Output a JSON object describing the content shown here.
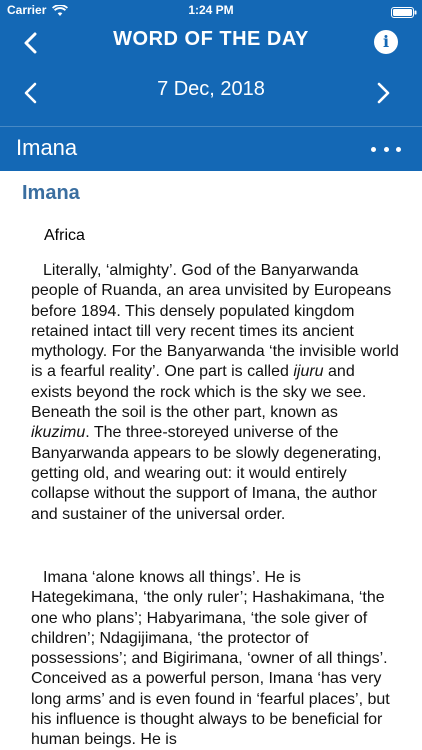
{
  "status_bar": {
    "carrier": "Carrier",
    "time": "1:24 PM"
  },
  "nav": {
    "title": "WORD OF THE DAY",
    "back_icon": "chevron-left-icon",
    "info_icon": "info-icon",
    "info_glyph": "i"
  },
  "date_bar": {
    "date": "7 Dec, 2018",
    "prev_icon": "chevron-left-icon",
    "next_icon": "chevron-right-icon"
  },
  "entry_bar": {
    "title": "Imana",
    "more_icon": "more-horizontal-icon"
  },
  "entry": {
    "heading": "Imana",
    "region": "Africa",
    "p1": [
      {
        "t": "Literally, ‘almighty’. God of the Banyarwanda people of Ruanda, an area unvisited by Europeans before 1894. This densely populated kingdom retained intact till very recent times its ancient mythology. For the Banyarwanda ‘the invisible world is a fearful reality’. One part is called "
      },
      {
        "t": "ijuru",
        "i": true
      },
      {
        "t": " and exists beyond the rock which is the sky we see. Beneath the soil is the other part, known as "
      },
      {
        "t": "ikuzimu",
        "i": true
      },
      {
        "t": ". The three-storeyed universe of the Banyarwanda appears to be slowly degenerating, getting old, and wearing out: it would entirely collapse without the support of Imana, the author and sustainer of the universal order."
      }
    ],
    "p2": "Imana ‘alone knows all things’. He is Hategekimana, ‘the only ruler’; Hashakimana, ‘the one who plans’; Habyarimana, ‘the sole giver of children’; Ndagijimana, ‘the protector of possessions’; and Bigirimana, ‘owner of all things’. Conceived as a powerful person, Imana ‘has very long arms’ and is even found in ‘fearful places’, but his influence is thought always to be beneficial for human beings. He is"
  }
}
